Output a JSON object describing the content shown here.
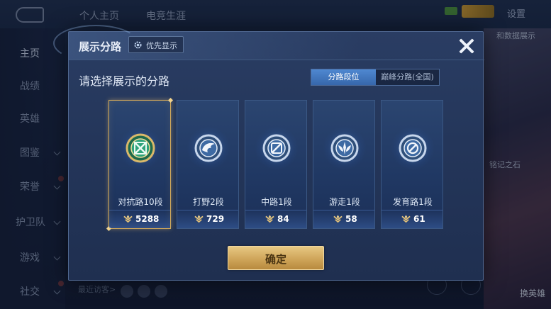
{
  "background": {
    "tabs": [
      "个人主页",
      "电竞生涯"
    ],
    "settings_label": "设置",
    "sidebar": [
      {
        "label": "主页",
        "active": true
      },
      {
        "label": "战绩"
      },
      {
        "label": "英雄"
      },
      {
        "label": "图鉴"
      },
      {
        "label": "荣誉"
      },
      {
        "label": "护卫队"
      },
      {
        "label": "游戏"
      },
      {
        "label": "社交"
      }
    ],
    "right_texts": [
      "和数据展示",
      "铭记之石"
    ],
    "recent_visitors": "最近访客>",
    "swap_hero": "换英雄"
  },
  "modal": {
    "title": "展示分路",
    "priority_button": "优先显示",
    "section_title": "请选择展示的分路",
    "segments": [
      {
        "label": "分路段位",
        "active": true
      },
      {
        "label": "巅峰分路(全国)",
        "active": false
      }
    ],
    "cards": [
      {
        "label": "对抗路10段",
        "count": "5288",
        "icon": "crossed-swords-emblem-icon",
        "selected": true
      },
      {
        "label": "打野2段",
        "count": "729",
        "icon": "dragon-emblem-icon",
        "selected": false
      },
      {
        "label": "中路1段",
        "count": "84",
        "icon": "slash-emblem-icon",
        "selected": false
      },
      {
        "label": "游走1段",
        "count": "58",
        "icon": "wing-emblem-icon",
        "selected": false
      },
      {
        "label": "发育路1段",
        "count": "61",
        "icon": "spiral-emblem-icon",
        "selected": false
      }
    ],
    "confirm_button": "确定"
  },
  "colors": {
    "selected_border": "#d2a95a",
    "active_segment": "#3f77c0",
    "confirm_gold": "#cfa55a"
  }
}
